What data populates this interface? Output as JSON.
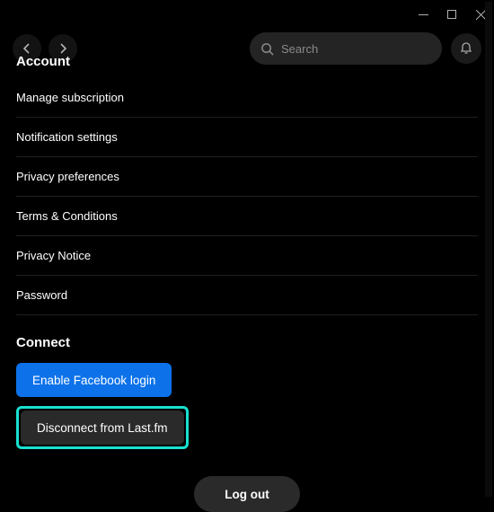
{
  "window": {
    "minimize": "minimize",
    "maximize": "maximize",
    "close": "close"
  },
  "topbar": {
    "back": "back",
    "forward": "forward",
    "search_placeholder": "Search",
    "bell": "notifications"
  },
  "account": {
    "heading": "Account",
    "rows": [
      {
        "label": "Manage subscription"
      },
      {
        "label": "Notification settings"
      },
      {
        "label": "Privacy preferences"
      },
      {
        "label": "Terms & Conditions"
      },
      {
        "label": "Privacy Notice"
      },
      {
        "label": "Password"
      }
    ]
  },
  "connect": {
    "heading": "Connect",
    "facebook_label": "Enable Facebook login",
    "lastfm_label": "Disconnect from Last.fm"
  },
  "logout": {
    "label": "Log out"
  },
  "colors": {
    "accent_blue": "#0d72ea",
    "highlight_teal": "#18e0d0",
    "divider": "#1f1f1f"
  }
}
